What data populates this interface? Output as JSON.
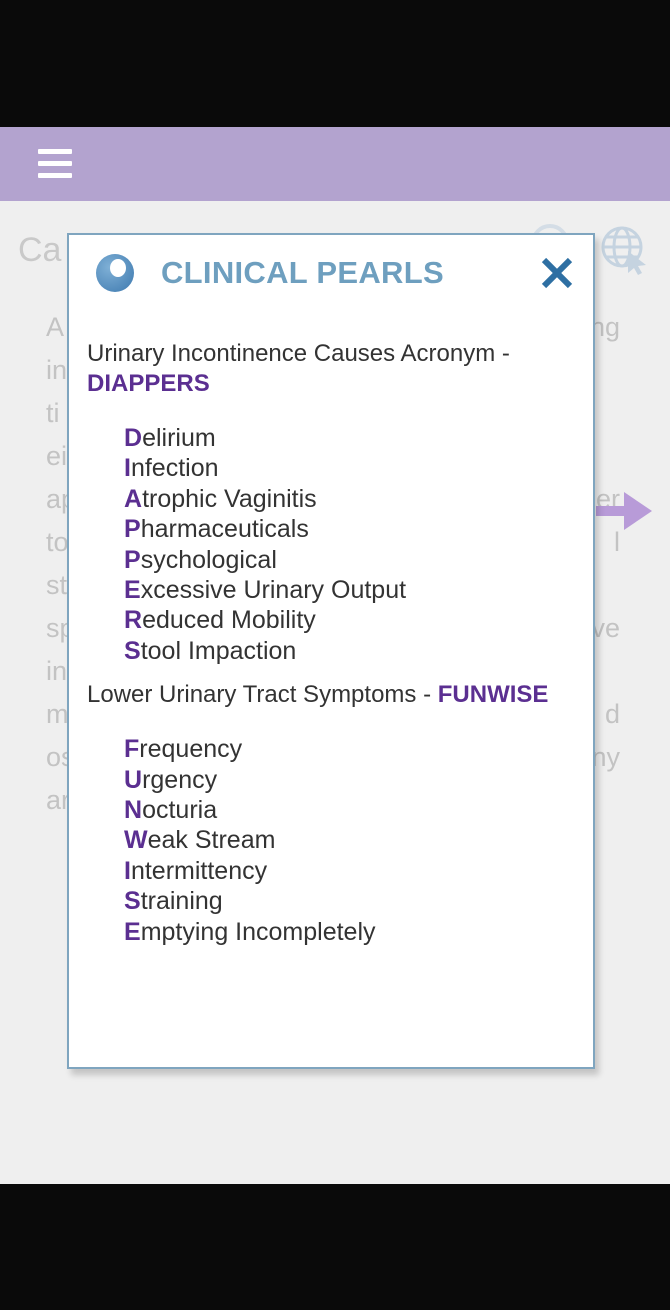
{
  "background": {
    "title_fragment": "Ca",
    "left_fragments": [
      "A",
      "in",
      "ti",
      "ei",
      "ap",
      "to",
      "st",
      "sp",
      "in",
      "m",
      "os",
      "ar"
    ],
    "right_fragments": [
      "ng",
      "",
      "",
      "",
      "er",
      "l",
      "",
      "ve",
      "",
      "d",
      "ny",
      ""
    ]
  },
  "modal": {
    "title": "CLINICAL PEARLS",
    "sections": [
      {
        "heading": "Urinary Incontinence Causes Acronym - ",
        "acronym": "DIAPPERS",
        "items": [
          {
            "first": "D",
            "rest": "elirium"
          },
          {
            "first": "I",
            "rest": "nfection"
          },
          {
            "first": "A",
            "rest": "trophic Vaginitis"
          },
          {
            "first": "P",
            "rest": "harmaceuticals"
          },
          {
            "first": "P",
            "rest": "sychological"
          },
          {
            "first": "E",
            "rest": "xcessive Urinary Output"
          },
          {
            "first": "R",
            "rest": "educed Mobility"
          },
          {
            "first": "S",
            "rest": "tool Impaction"
          }
        ]
      },
      {
        "heading": "Lower Urinary Tract Symptoms - ",
        "acronym": "FUNWISE",
        "items": [
          {
            "first": "F",
            "rest": "requency"
          },
          {
            "first": "U",
            "rest": "rgency"
          },
          {
            "first": "N",
            "rest": "octuria"
          },
          {
            "first": "W",
            "rest": "eak Stream"
          },
          {
            "first": "I",
            "rest": "ntermittency"
          },
          {
            "first": "S",
            "rest": "training"
          },
          {
            "first": "E",
            "rest": "mptying Incompletely"
          }
        ]
      }
    ]
  },
  "colors": {
    "header": "#b3a3cf",
    "accent_purple": "#5b2f91",
    "title_blue": "#6e9fbf",
    "close_blue": "#2e6fa3"
  },
  "icons": [
    "menu-icon",
    "pearl-icon",
    "close-icon",
    "globe-icon",
    "flag-icon",
    "arrow-right-icon"
  ]
}
